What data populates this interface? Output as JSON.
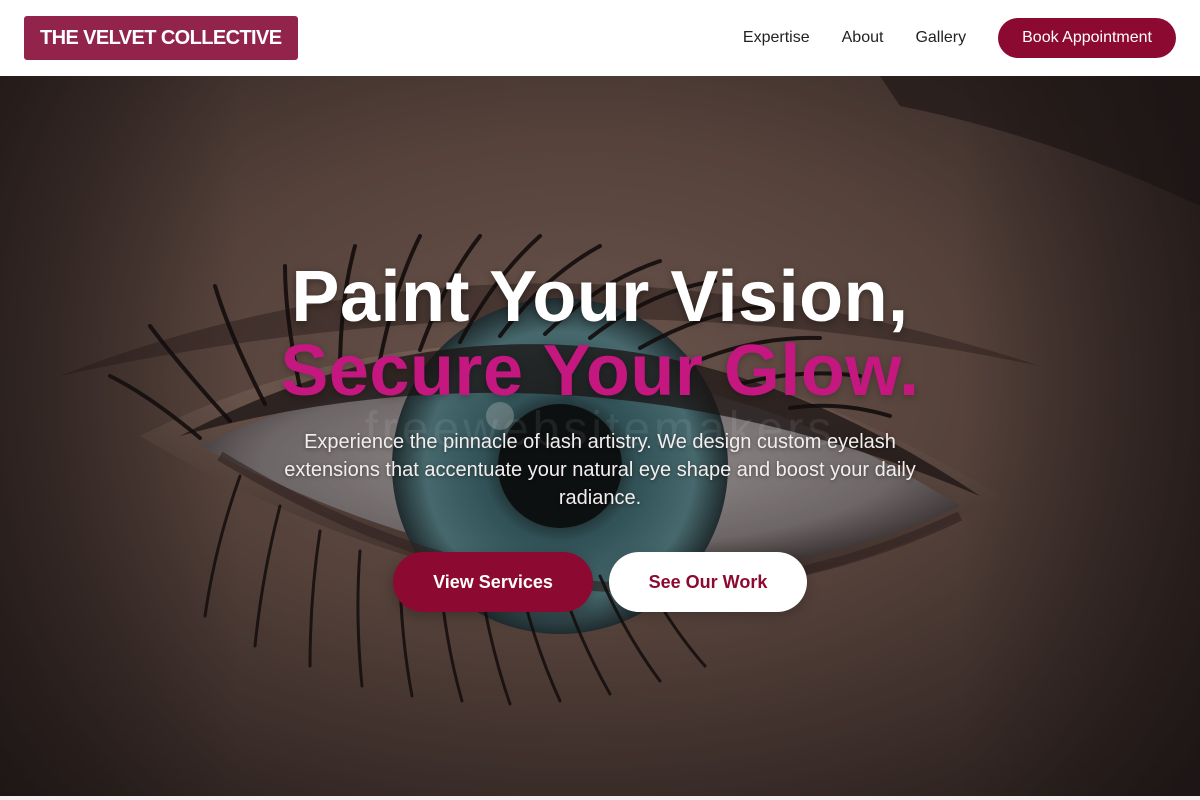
{
  "header": {
    "logo_text": "THE VELVET COLLECTIVE",
    "nav": [
      {
        "label": "Expertise"
      },
      {
        "label": "About"
      },
      {
        "label": "Gallery"
      }
    ],
    "cta_label": "Book Appointment"
  },
  "hero": {
    "title_line_1": "Paint Your Vision,",
    "title_line_2": "Secure Your Glow.",
    "watermark": "freewebsitemakers",
    "subtitle": "Experience the pinnacle of lash artistry. We design custom eyelash extensions that accentuate your natural eye shape and boost your daily radiance.",
    "primary_button": "View Services",
    "secondary_button": "See Our Work",
    "background_image": "close-up-eye-with-eyelashes"
  },
  "colors": {
    "brand": "#8c0a31",
    "logo_bg": "#92244c",
    "accent_text": "#c4177f",
    "header_bg": "#ffffff"
  }
}
